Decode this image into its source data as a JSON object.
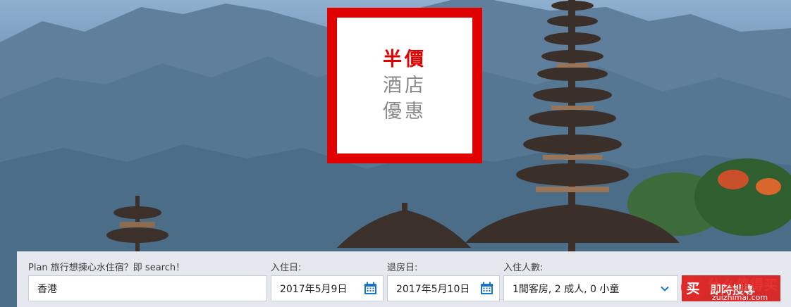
{
  "promo": {
    "line1": "半價",
    "line2": "酒店",
    "line3": "優惠"
  },
  "search": {
    "destination_label": "Plan 旅行想揀心水住宿？即 search！",
    "destination_value": "香港",
    "checkin_label": "入住日:",
    "checkin_value": "2017年5月9日",
    "checkout_label": "退房日:",
    "checkout_value": "2017年5月10日",
    "guests_label": "入住人數:",
    "guests_value": "1間客房, 2 成人, 0 小童",
    "search_button": "即時搜尋"
  },
  "watermark": {
    "logo_char": "买",
    "text": "什么值得买",
    "sub": "zuizhimai.com"
  },
  "colors": {
    "promo_red": "#e10000",
    "accent_blue": "#1a73c7",
    "button_red": "#d72b2b"
  },
  "icons": [
    "calendar-icon",
    "chevron-down-icon"
  ]
}
